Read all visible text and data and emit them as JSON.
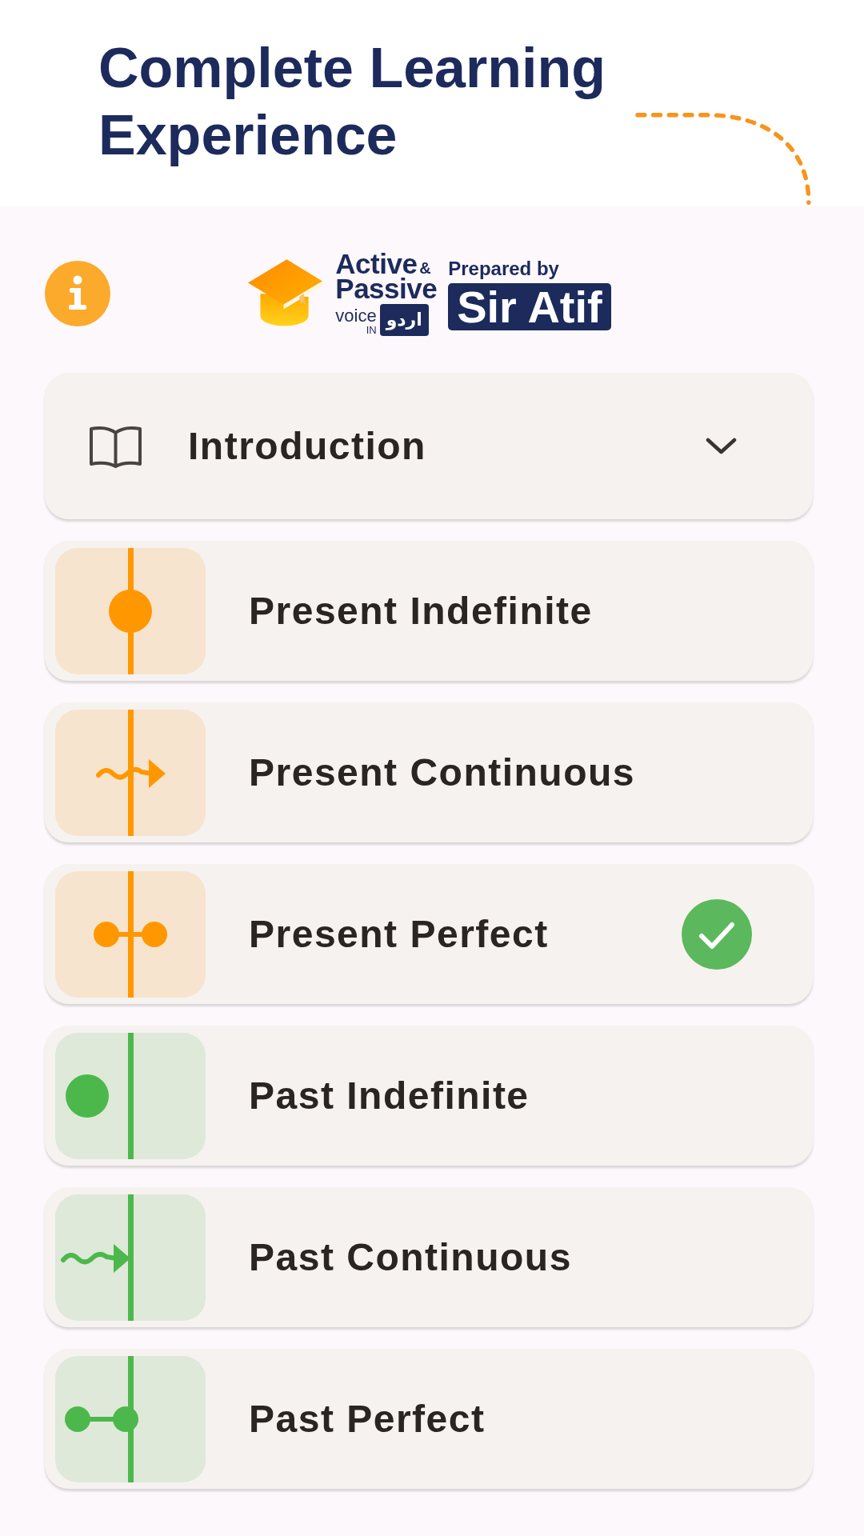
{
  "header": {
    "title": "Complete Learning Experience"
  },
  "logo": {
    "title_line_1": "Active",
    "ampersand": "&",
    "title_line_2": "Passive",
    "subtitle": "voice",
    "in": "IN",
    "language": "اردو",
    "credit": "Prepared by",
    "author": "Sir Atif"
  },
  "introduction": {
    "label": "Introduction",
    "expanded": false
  },
  "tenses": [
    {
      "label": "Present Indefinite",
      "past": false,
      "kind": "indefinite",
      "color": "#ff9800",
      "completed": false
    },
    {
      "label": "Present Continuous",
      "past": false,
      "kind": "continuous",
      "color": "#ff9800",
      "completed": false
    },
    {
      "label": "Present Perfect",
      "past": false,
      "kind": "perfect",
      "color": "#ff9800",
      "completed": true
    },
    {
      "label": "Past Indefinite",
      "past": true,
      "kind": "indefinite",
      "color": "#4cb84c",
      "completed": false
    },
    {
      "label": "Past Continuous",
      "past": true,
      "kind": "continuous",
      "color": "#4cb84c",
      "completed": false
    },
    {
      "label": "Past Perfect",
      "past": true,
      "kind": "perfect",
      "color": "#4cb84c",
      "completed": false
    }
  ]
}
